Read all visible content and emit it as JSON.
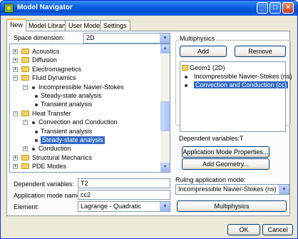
{
  "window": {
    "title": "Model Navigator",
    "minimize": "_",
    "maximize": "□",
    "close": "×"
  },
  "tabs": [
    "New",
    "Model Library",
    "User Models",
    "Settings"
  ],
  "space_dimension": {
    "label": "Space dimension:",
    "value": "2D"
  },
  "tree": {
    "items": [
      {
        "label": "Acoustics",
        "type": "folder",
        "expander": "+"
      },
      {
        "label": "Diffusion",
        "type": "folder",
        "expander": "+"
      },
      {
        "label": "Electromagnetics",
        "type": "folder",
        "expander": "+"
      },
      {
        "label": "Fluid Dynamics",
        "type": "folder",
        "expander": "−"
      },
      {
        "label": "Incompressible Navier-Stokes",
        "type": "node",
        "expander": "−"
      },
      {
        "label": "Steady-state analysis",
        "type": "leaf"
      },
      {
        "label": "Transient analysis",
        "type": "leaf"
      },
      {
        "label": "Heat Transfer",
        "type": "folder",
        "expander": "−"
      },
      {
        "label": "Convection and Conduction",
        "type": "node",
        "expander": "−"
      },
      {
        "label": "Transient analysis",
        "type": "leaf"
      },
      {
        "label": "Steady-state analysis",
        "type": "leaf",
        "selected": true
      },
      {
        "label": "Conduction",
        "type": "node",
        "expander": "+"
      },
      {
        "label": "Structural Mechanics",
        "type": "folder",
        "expander": "+"
      },
      {
        "label": "PDE Modes",
        "type": "folder",
        "expander": "+"
      }
    ]
  },
  "fields": {
    "dependent_variables": {
      "label": "Dependent variables:",
      "value": "T2"
    },
    "application_mode_name": {
      "label": "Application mode name:",
      "value": "cc2"
    },
    "element": {
      "label": "Element:",
      "value": "Lagrange - Quadratic"
    }
  },
  "multiphysics": {
    "group_label": "Multiphysics",
    "add": "Add",
    "remove": "Remove",
    "geom": "Geom1 (2D)",
    "modes": [
      {
        "label": "Incompressible Navier-Stokes (ns)",
        "selected": false
      },
      {
        "label": "Convection and Conduction (cc)",
        "selected": true
      }
    ],
    "dependent_variables_label": "Dependent variables:",
    "dependent_variables_value": "T",
    "app_mode_properties": "Application Mode Properties...",
    "add_geometry": "Add Geometry...",
    "ruling_label": "Ruling application mode:",
    "ruling_value": "Incompressible Navier-Stokes (ns)",
    "multiphysics_button": "Multiphysics"
  },
  "footer": {
    "ok": "OK",
    "cancel": "Cancel"
  },
  "colors": {
    "title_bar": "#0a5ee3",
    "selection": "#316ac5",
    "window_bg": "#ece9d8"
  }
}
